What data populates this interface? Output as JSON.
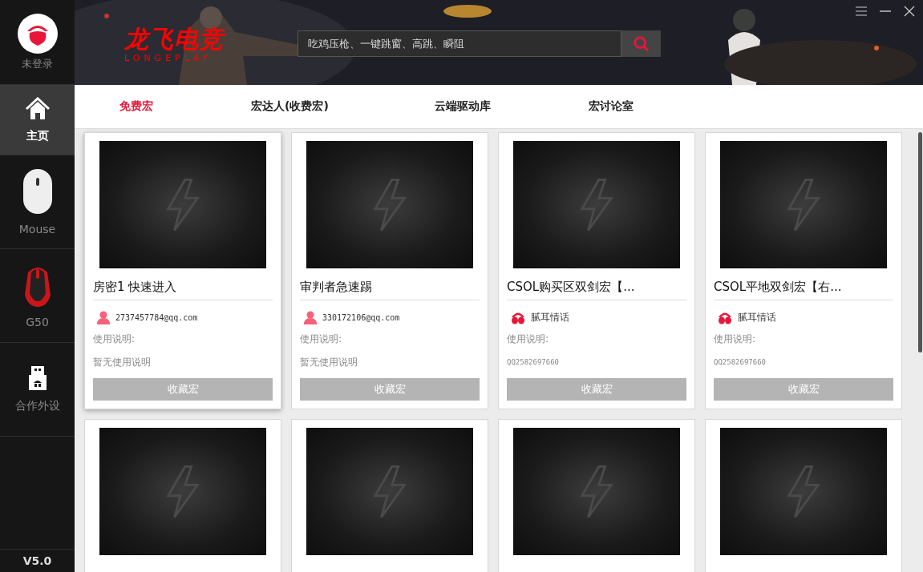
{
  "user": {
    "label": "未登录"
  },
  "sidebar": {
    "items": [
      {
        "label": "主页",
        "kind": "home",
        "selected": true
      },
      {
        "label": "Mouse",
        "kind": "mouse",
        "selected": false
      },
      {
        "label": "G50",
        "kind": "gaming-mouse",
        "selected": false
      },
      {
        "label": "合作外设",
        "kind": "usb",
        "selected": false
      }
    ],
    "version": "V5.0"
  },
  "header": {
    "logo": {
      "title": "龙飞电竞",
      "subtitle": "LONGEPLAY"
    },
    "search": {
      "placeholder": "吃鸡压枪、一键跳窗、高跳、瞬阻"
    }
  },
  "tabs": [
    {
      "label": "免费宏",
      "selected": true
    },
    {
      "label": "宏达人(收费宏)",
      "selected": false
    },
    {
      "label": "云端驱动库",
      "selected": false
    },
    {
      "label": "宏讨论室",
      "selected": false
    }
  ],
  "cards": [
    {
      "title": "房密1 快速进入",
      "author": "2737457784@qq.com",
      "kind": "person",
      "usage_label": "使用说明:",
      "usage": "暂无使用说明",
      "button": "收藏宏",
      "hovered": true
    },
    {
      "title": "审判者急速踢",
      "author": "330172106@qq.com",
      "kind": "person",
      "usage_label": "使用说明:",
      "usage": "暂无使用说明",
      "button": "收藏宏",
      "hovered": false
    },
    {
      "title": "CSOL购买区双剑宏【...",
      "author": "腻耳情话",
      "kind": "brand",
      "usage_label": "使用说明:",
      "usage": "QQ2582697660",
      "button": "收藏宏",
      "hovered": false
    },
    {
      "title": "CSOL平地双剑宏【右...",
      "author": "腻耳情话",
      "kind": "brand",
      "usage_label": "使用说明:",
      "usage": "QQ2582697660",
      "button": "收藏宏",
      "hovered": false
    },
    {
      "hovered": false
    },
    {
      "hovered": false
    },
    {
      "hovered": false
    },
    {
      "hovered": false
    }
  ]
}
